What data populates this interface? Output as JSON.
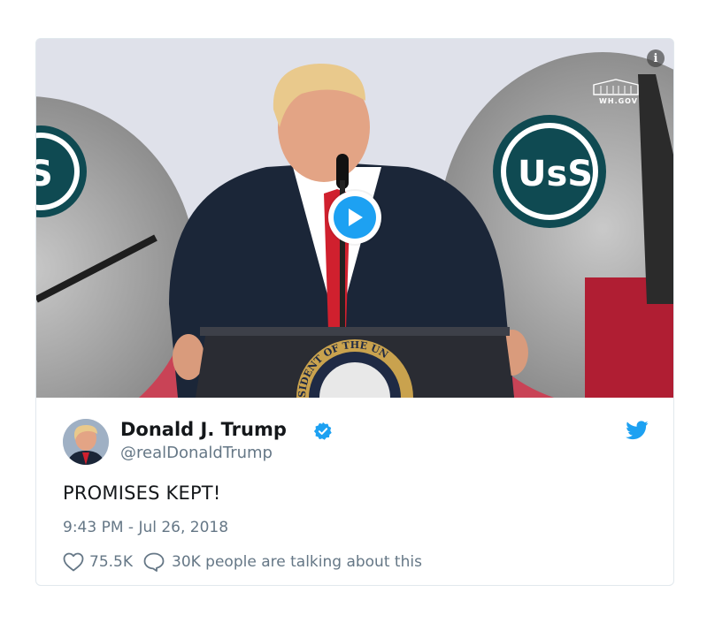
{
  "media": {
    "watermark_text": "WH.GOV",
    "podium_seal_text": "SIDENT OF THE UN",
    "banner_logo_text": "USS",
    "info_icon": "info-icon",
    "play_icon": "play-icon",
    "colors": {
      "play_accent": "#1da1f2",
      "tie": "#d0202e"
    }
  },
  "tweet": {
    "author_name": "Donald J. Trump",
    "handle": "@realDonaldTrump",
    "text": "PROMISES KEPT!",
    "timestamp": "9:43 PM - Jul 26, 2018",
    "likes": "75.5K",
    "conversation": "30K people are talking about this",
    "icons": {
      "verified": "verified-badge-icon",
      "brand": "twitter-bird-icon",
      "like": "heart-icon",
      "reply": "comment-bubble-icon"
    },
    "colors": {
      "brand": "#1da1f2",
      "muted": "#657786",
      "text": "#14171a"
    }
  }
}
